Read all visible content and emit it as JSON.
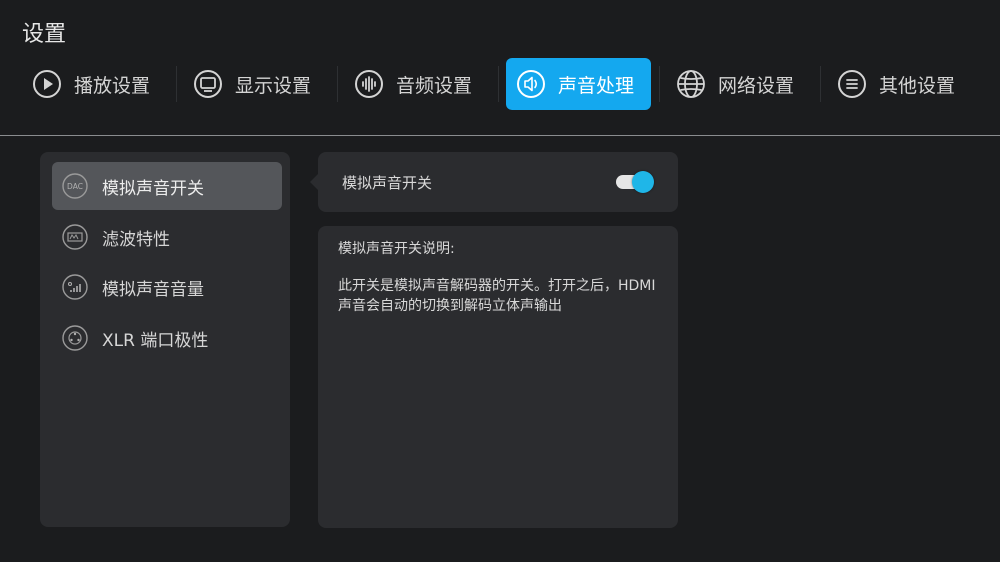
{
  "header": {
    "title": "设置"
  },
  "tabs": [
    {
      "label": "播放设置",
      "icon": "play-icon",
      "active": false
    },
    {
      "label": "显示设置",
      "icon": "monitor-icon",
      "active": false
    },
    {
      "label": "音频设置",
      "icon": "audio-wave-icon",
      "active": false
    },
    {
      "label": "声音处理",
      "icon": "speaker-icon",
      "active": true
    },
    {
      "label": "网络设置",
      "icon": "globe-icon",
      "active": false
    },
    {
      "label": "其他设置",
      "icon": "menu-icon",
      "active": false
    }
  ],
  "sidebar": {
    "items": [
      {
        "label": "模拟声音开关",
        "icon": "dac-icon",
        "icon_text": "DAC",
        "selected": true
      },
      {
        "label": "滤波特性",
        "icon": "filter-icon",
        "selected": false
      },
      {
        "label": "模拟声音音量",
        "icon": "volume-level-icon",
        "selected": false
      },
      {
        "label": "XLR 端口极性",
        "icon": "xlr-port-icon",
        "selected": false
      }
    ]
  },
  "setting": {
    "label": "模拟声音开关",
    "toggle_on": true
  },
  "description": {
    "title": "模拟声音开关说明:",
    "body": "此开关是模拟声音解码器的开关。打开之后，HDMI声音会自动的切换到解码立体声输出"
  },
  "colors": {
    "accent": "#14a8ef",
    "background": "#1b1c1e",
    "panel": "#2b2c2f",
    "selected": "#54565a"
  }
}
